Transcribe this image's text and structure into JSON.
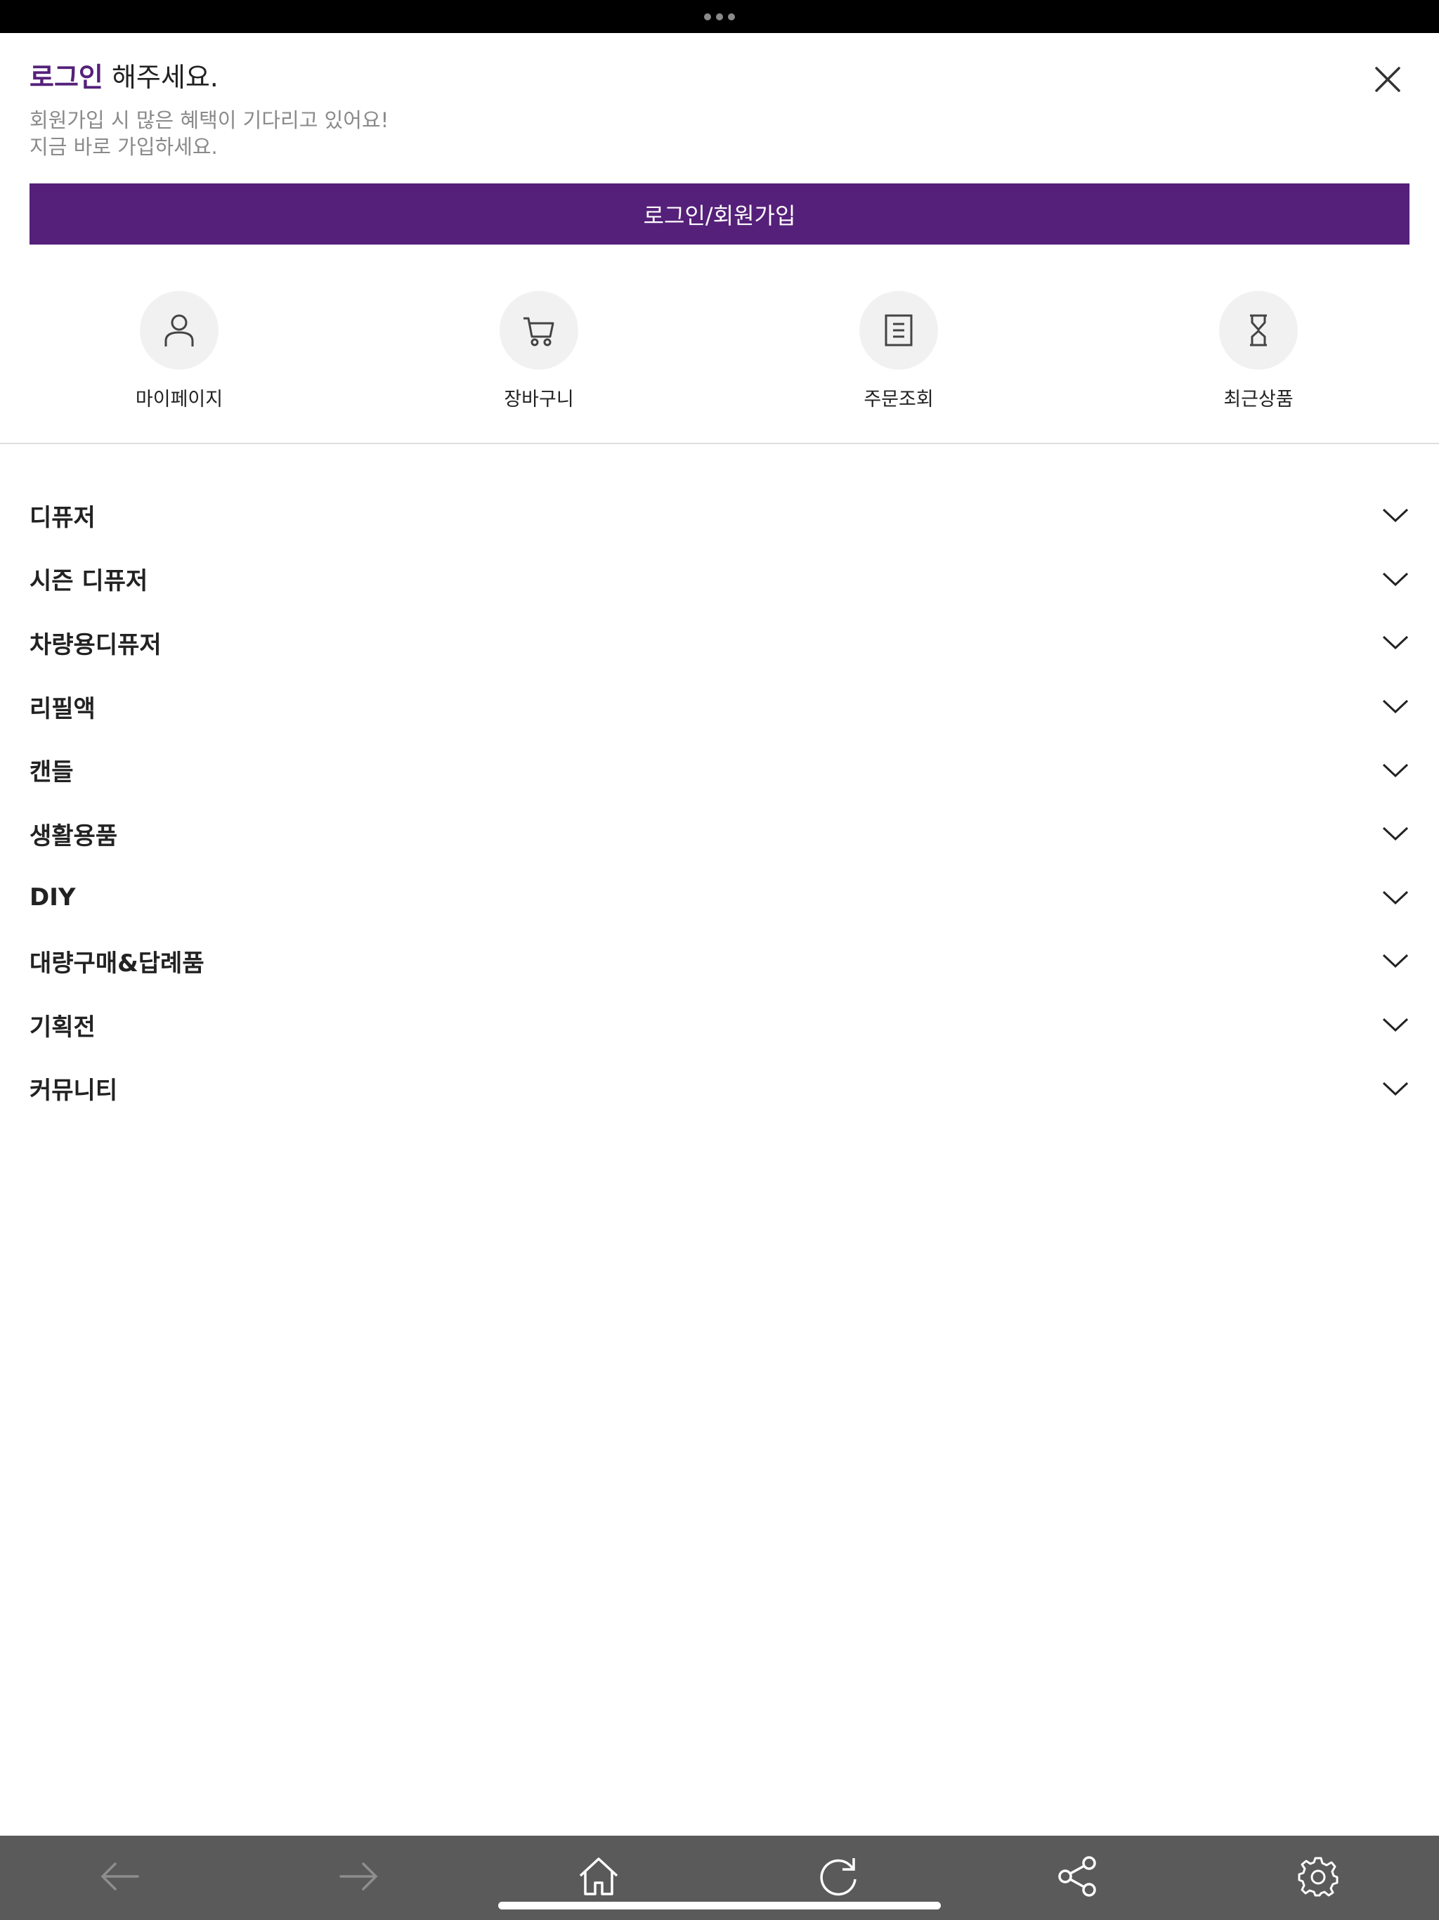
{
  "header": {
    "greeting_accent": "로그인",
    "greeting_rest": " 해주세요.",
    "sub_line1": "회원가입 시 많은 혜택이 기다리고 있어요!",
    "sub_line2": "지금 바로 가입하세요.",
    "login_button": "로그인/회원가입",
    "close_icon": "close-icon"
  },
  "quick_links": [
    {
      "label": "마이페이지",
      "icon": "user-icon"
    },
    {
      "label": "장바구니",
      "icon": "cart-icon"
    },
    {
      "label": "주문조회",
      "icon": "order-list-icon"
    },
    {
      "label": "최근상품",
      "icon": "hourglass-icon"
    }
  ],
  "categories": [
    {
      "label": "디퓨저"
    },
    {
      "label": "시즌 디퓨저"
    },
    {
      "label": "차량용디퓨저"
    },
    {
      "label": "리필액"
    },
    {
      "label": "캔들"
    },
    {
      "label": "생활용품"
    },
    {
      "label": "DIY"
    },
    {
      "label": "대량구매&답례품"
    },
    {
      "label": "기획전"
    },
    {
      "label": "커뮤니티"
    }
  ],
  "bottom_nav": [
    "back-arrow-icon",
    "forward-arrow-icon",
    "home-icon",
    "refresh-icon",
    "share-icon",
    "settings-icon"
  ],
  "colors": {
    "accent": "#55207a",
    "bottom_bar": "#5a5a5a"
  }
}
